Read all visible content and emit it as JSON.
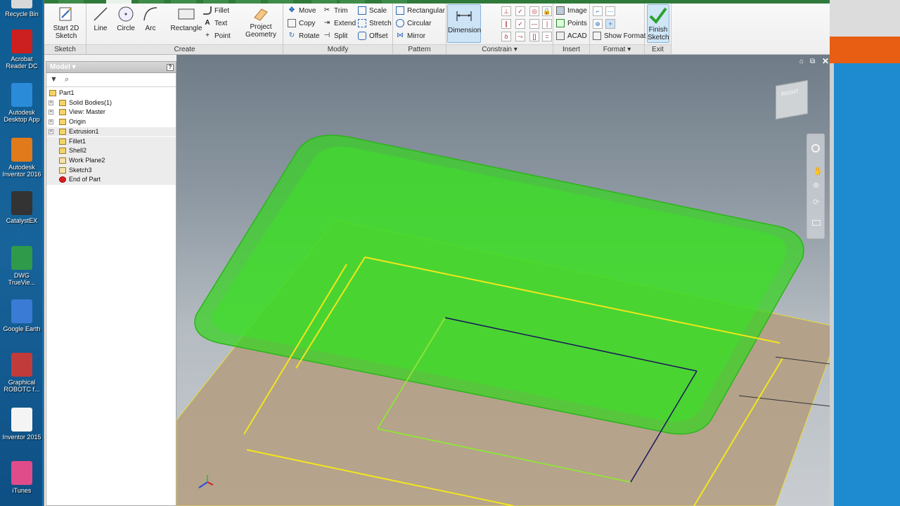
{
  "desktop": {
    "icons": [
      {
        "label": "Recycle Bin",
        "icon": "recycle-bin-icon",
        "color": "#d8d8d8"
      },
      {
        "label": "Acrobat Reader DC",
        "icon": "acrobat-icon",
        "color": "#cc1f1f"
      },
      {
        "label": "Autodesk Desktop App",
        "icon": "autodesk-app-icon",
        "color": "#2a8bd8"
      },
      {
        "label": "Autodesk Inventor 2016",
        "icon": "inventor-icon",
        "color": "#e07a1a"
      },
      {
        "label": "CatalystEX",
        "icon": "catalystex-icon",
        "color": "#333333"
      },
      {
        "label": "DWG TrueVie...",
        "icon": "dwg-trueview-icon",
        "color": "#2e9a4a"
      },
      {
        "label": "Google Earth",
        "icon": "google-earth-icon",
        "color": "#3a7bd5"
      },
      {
        "label": "Graphical ROBOTC f...",
        "icon": "robotc-icon",
        "color": "#c23b3b"
      },
      {
        "label": "Inventor 2015",
        "icon": "document-icon",
        "color": "#f4f4f4"
      },
      {
        "label": "iTunes",
        "icon": "itunes-icon",
        "color": "#e04b8a"
      }
    ]
  },
  "ribbon": {
    "sketch_panel": {
      "title": "Sketch",
      "start_label": "Start 2D Sketch"
    },
    "create_panel": {
      "title": "Create",
      "line": "Line",
      "circle": "Circle",
      "arc": "Arc",
      "rectangle": "Rectangle",
      "fillet": "Fillet",
      "text": "Text",
      "point": "Point",
      "project": "Project Geometry"
    },
    "modify_panel": {
      "title": "Modify",
      "move": "Move",
      "copy": "Copy",
      "rotate": "Rotate",
      "trim": "Trim",
      "extend": "Extend",
      "split": "Split",
      "scale": "Scale",
      "stretch": "Stretch",
      "offset": "Offset"
    },
    "pattern_panel": {
      "title": "Pattern",
      "rectangular": "Rectangular",
      "circular": "Circular",
      "mirror": "Mirror"
    },
    "constrain_panel": {
      "title": "Constrain",
      "dimension": "Dimension"
    },
    "insert_panel": {
      "title": "Insert",
      "image": "Image",
      "points": "Points",
      "acad": "ACAD"
    },
    "format_panel": {
      "title": "Format",
      "show_format": "Show Format"
    },
    "exit_panel": {
      "title": "Exit",
      "finish": "Finish Sketch"
    }
  },
  "browser": {
    "header": "Model",
    "tree": [
      {
        "label": "Part1",
        "icon": "part-icon",
        "level": 0
      },
      {
        "label": "Solid Bodies(1)",
        "icon": "solid-bodies-icon",
        "level": 1
      },
      {
        "label": "View: Master",
        "icon": "view-icon",
        "level": 1
      },
      {
        "label": "Origin",
        "icon": "folder-icon",
        "level": 1
      },
      {
        "label": "Extrusion1",
        "icon": "extrusion-icon",
        "level": 1
      },
      {
        "label": "Fillet1",
        "icon": "fillet-icon",
        "level": 1
      },
      {
        "label": "Shell2",
        "icon": "shell-icon",
        "level": 1
      },
      {
        "label": "Work Plane2",
        "icon": "work-plane-icon",
        "level": 1
      },
      {
        "label": "Sketch3",
        "icon": "sketch-icon",
        "level": 1
      },
      {
        "label": "End of Part",
        "icon": "end-of-part-icon",
        "level": 1
      }
    ]
  },
  "viewcube": {
    "face_label": "RIGHT"
  },
  "colors": {
    "part_green": "#35d41f",
    "sketch_yellow": "#f2e61c",
    "sketch_green": "#8fe636",
    "sketch_navy": "#18185a",
    "plane_tan": "#b39c80"
  }
}
